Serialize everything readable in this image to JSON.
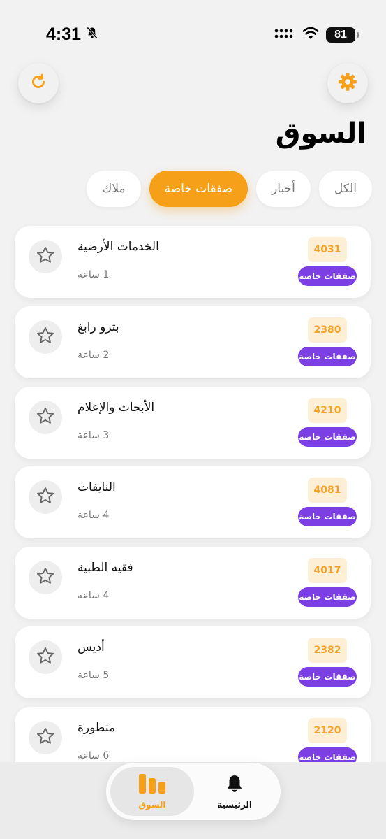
{
  "status_bar": {
    "time": "4:31",
    "battery": "81"
  },
  "colors": {
    "accent": "#f6a01a",
    "badge_purple": "#7b3fe4",
    "code_bg": "#fdeed6"
  },
  "header": {
    "title": "السوق",
    "settings_icon": "gear-icon",
    "refresh_icon": "refresh-icon"
  },
  "filters": [
    {
      "label": "الكل",
      "active": false
    },
    {
      "label": "أخبار",
      "active": false
    },
    {
      "label": "صفقات خاصة",
      "active": true
    },
    {
      "label": "ملاك",
      "active": false
    }
  ],
  "items": [
    {
      "title": "الخدمات الأرضية",
      "time": "1 ساعة",
      "code": "4031",
      "category": "صفقات خاصة"
    },
    {
      "title": "بترو رابغ",
      "time": "2 ساعة",
      "code": "2380",
      "category": "صفقات خاصة"
    },
    {
      "title": "الأبحاث والإعلام",
      "time": "3 ساعة",
      "code": "4210",
      "category": "صفقات خاصة"
    },
    {
      "title": "النايفات",
      "time": "4 ساعة",
      "code": "4081",
      "category": "صفقات خاصة"
    },
    {
      "title": "فقيه الطبية",
      "time": "4 ساعة",
      "code": "4017",
      "category": "صفقات خاصة"
    },
    {
      "title": "أديس",
      "time": "5 ساعة",
      "code": "2382",
      "category": "صفقات خاصة"
    },
    {
      "title": "متطورة",
      "time": "6 ساعة",
      "code": "2120",
      "category": "صفقات خاصة"
    }
  ],
  "tabbar": {
    "market": "السوق",
    "home": "الرئيسية"
  }
}
